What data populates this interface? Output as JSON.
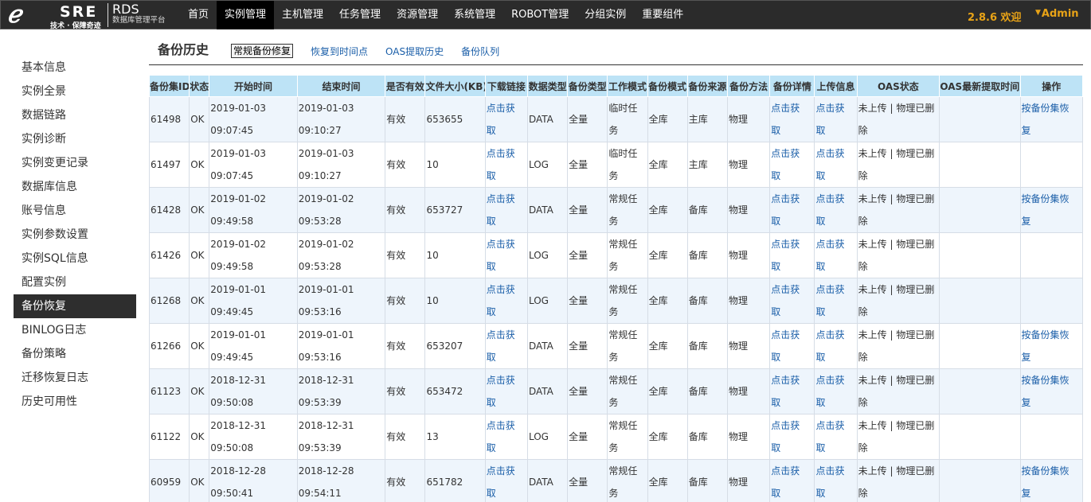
{
  "header": {
    "logo_mark": "ℯ",
    "logo_text": "SRE",
    "logo_slogan": "技术 · 保障奇迹",
    "brand_title": "RDS",
    "brand_subtitle": "数据库管理平台",
    "nav": [
      "首页",
      "实例管理",
      "主机管理",
      "任务管理",
      "资源管理",
      "系统管理",
      "ROBOT管理",
      "分组实例",
      "重要组件"
    ],
    "active_nav": "实例管理",
    "version": "2.8.6 欢迎",
    "user": "Admin",
    "accent": "#e8a317"
  },
  "sidebar": {
    "items": [
      "基本信息",
      "实例全景",
      "数据链路",
      "实例诊断",
      "实例变更记录",
      "数据库信息",
      "账号信息",
      "实例参数设置",
      "实例SQL信息",
      "配置实例",
      "备份恢复",
      "BINLOG日志",
      "备份策略",
      "迁移恢复日志",
      "历史可用性"
    ],
    "active": "备份恢复"
  },
  "page": {
    "title": "备份历史",
    "tabs": {
      "button": "常规备份修复",
      "links": [
        "恢复到时间点",
        "OAS提取历史",
        "备份队列"
      ]
    }
  },
  "table": {
    "columns": [
      "备份集ID",
      "状态",
      "开始时间",
      "结束时间",
      "是否有效",
      "文件大小(KB)",
      "下载链接",
      "数据类型",
      "备份类型",
      "工作模式",
      "备份模式",
      "备份来源",
      "备份方法",
      "备份详情",
      "上传信息",
      "OAS状态",
      "OAS最新提取时间",
      "操作"
    ],
    "link_text": "点击获取",
    "rows": [
      {
        "id": "61498",
        "status": "OK",
        "start_date": "2019-01-03",
        "start_time": "09:07:45",
        "end_date": "2019-01-03",
        "end_time": "09:10:27",
        "valid": "有效",
        "size": "653655",
        "data_type": "DATA",
        "backup_type": "全量",
        "work_mode": "临时任务",
        "backup_mode": "全库",
        "source": "主库",
        "method": "物理",
        "oas_status": "未上传 | 物理已删除",
        "oas_time": "",
        "action": "按备份集恢复"
      },
      {
        "id": "61497",
        "status": "OK",
        "start_date": "2019-01-03",
        "start_time": "09:07:45",
        "end_date": "2019-01-03",
        "end_time": "09:10:27",
        "valid": "有效",
        "size": "10",
        "data_type": "LOG",
        "backup_type": "全量",
        "work_mode": "临时任务",
        "backup_mode": "全库",
        "source": "主库",
        "method": "物理",
        "oas_status": "未上传 | 物理已删除",
        "oas_time": "",
        "action": ""
      },
      {
        "id": "61428",
        "status": "OK",
        "start_date": "2019-01-02",
        "start_time": "09:49:58",
        "end_date": "2019-01-02",
        "end_time": "09:53:28",
        "valid": "有效",
        "size": "653727",
        "data_type": "DATA",
        "backup_type": "全量",
        "work_mode": "常规任务",
        "backup_mode": "全库",
        "source": "备库",
        "method": "物理",
        "oas_status": "未上传 | 物理已删除",
        "oas_time": "",
        "action": "按备份集恢复"
      },
      {
        "id": "61426",
        "status": "OK",
        "start_date": "2019-01-02",
        "start_time": "09:49:58",
        "end_date": "2019-01-02",
        "end_time": "09:53:28",
        "valid": "有效",
        "size": "10",
        "data_type": "LOG",
        "backup_type": "全量",
        "work_mode": "常规任务",
        "backup_mode": "全库",
        "source": "备库",
        "method": "物理",
        "oas_status": "未上传 | 物理已删除",
        "oas_time": "",
        "action": ""
      },
      {
        "id": "61268",
        "status": "OK",
        "start_date": "2019-01-01",
        "start_time": "09:49:45",
        "end_date": "2019-01-01",
        "end_time": "09:53:16",
        "valid": "有效",
        "size": "10",
        "data_type": "LOG",
        "backup_type": "全量",
        "work_mode": "常规任务",
        "backup_mode": "全库",
        "source": "备库",
        "method": "物理",
        "oas_status": "未上传 | 物理已删除",
        "oas_time": "",
        "action": ""
      },
      {
        "id": "61266",
        "status": "OK",
        "start_date": "2019-01-01",
        "start_time": "09:49:45",
        "end_date": "2019-01-01",
        "end_time": "09:53:16",
        "valid": "有效",
        "size": "653207",
        "data_type": "DATA",
        "backup_type": "全量",
        "work_mode": "常规任务",
        "backup_mode": "全库",
        "source": "备库",
        "method": "物理",
        "oas_status": "未上传 | 物理已删除",
        "oas_time": "",
        "action": "按备份集恢复"
      },
      {
        "id": "61123",
        "status": "OK",
        "start_date": "2018-12-31",
        "start_time": "09:50:08",
        "end_date": "2018-12-31",
        "end_time": "09:53:39",
        "valid": "有效",
        "size": "653472",
        "data_type": "DATA",
        "backup_type": "全量",
        "work_mode": "常规任务",
        "backup_mode": "全库",
        "source": "备库",
        "method": "物理",
        "oas_status": "未上传 | 物理已删除",
        "oas_time": "",
        "action": "按备份集恢复"
      },
      {
        "id": "61122",
        "status": "OK",
        "start_date": "2018-12-31",
        "start_time": "09:50:08",
        "end_date": "2018-12-31",
        "end_time": "09:53:39",
        "valid": "有效",
        "size": "13",
        "data_type": "LOG",
        "backup_type": "全量",
        "work_mode": "常规任务",
        "backup_mode": "全库",
        "source": "备库",
        "method": "物理",
        "oas_status": "未上传 | 物理已删除",
        "oas_time": "",
        "action": ""
      },
      {
        "id": "60959",
        "status": "OK",
        "start_date": "2018-12-28",
        "start_time": "09:50:41",
        "end_date": "2018-12-28",
        "end_time": "09:54:11",
        "valid": "有效",
        "size": "651782",
        "data_type": "DATA",
        "backup_type": "全量",
        "work_mode": "常规任务",
        "backup_mode": "全库",
        "source": "备库",
        "method": "物理",
        "oas_status": "未上传 | 物理已删除",
        "oas_time": "",
        "action": "按备份集恢复"
      }
    ]
  }
}
